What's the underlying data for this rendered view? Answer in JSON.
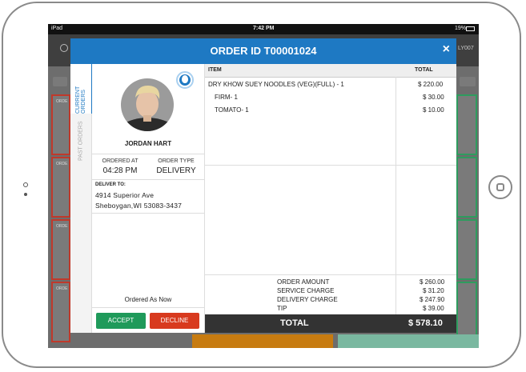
{
  "status_bar": {
    "carrier": "iPad",
    "time": "7:42 PM",
    "battery": "19%"
  },
  "background": {
    "clipped_id_top_right": "LY007"
  },
  "modal": {
    "title": "ORDER ID T00001024",
    "close": "×"
  },
  "side_tabs": {
    "current": "CURRENT ORDERS",
    "past": "PAST ORDERS"
  },
  "customer": {
    "name": "JORDAN HART",
    "ordered_at_label": "ORDERED AT",
    "ordered_at": "04:28 PM",
    "order_type_label": "ORDER TYPE",
    "order_type": "DELIVERY",
    "deliver_to_label": "DELIVER TO:",
    "address_line1": "4914 Superior Ave",
    "address_line2": "Sheboygan,WI 53083-3437",
    "ordered_note": "Ordered As Now"
  },
  "actions": {
    "accept": "ACCEPT",
    "decline": "DECLINE"
  },
  "items": {
    "header_item": "ITEM",
    "header_total": "TOTAL",
    "rows": [
      {
        "name": "DRY KHOW SUEY NOODLES (VEG)(FULL) - 1",
        "total": "$ 220.00"
      },
      {
        "name": "FIRM- 1",
        "total": "$ 30.00"
      },
      {
        "name": "TOMATO- 1",
        "total": "$ 10.00"
      }
    ]
  },
  "charges": [
    {
      "label": "ORDER AMOUNT",
      "value": "$ 260.00"
    },
    {
      "label": "SERVICE CHARGE",
      "value": "$ 31.20"
    },
    {
      "label": "DELIVERY CHARGE",
      "value": "$ 247.90"
    },
    {
      "label": "TIP",
      "value": "$ 39.00"
    }
  ],
  "total": {
    "label": "TOTAL",
    "value": "$ 578.10"
  },
  "colors": {
    "header_blue": "#1e79c3",
    "accept_green": "#1f9a5a",
    "decline_red": "#d83a1e",
    "total_bar": "#333333"
  }
}
